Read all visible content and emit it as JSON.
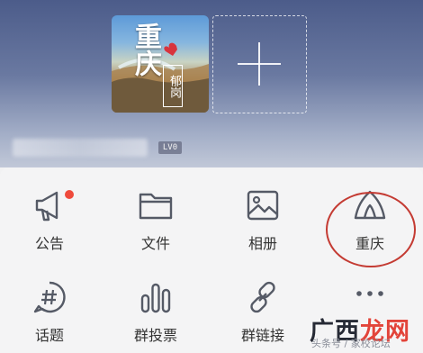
{
  "header": {
    "cover_title": "重庆",
    "cover_subtitle": "郁岗",
    "level_badge": "LV0"
  },
  "menu": [
    {
      "label": "公告",
      "icon": "megaphone-icon",
      "has_dot": true
    },
    {
      "label": "文件",
      "icon": "folder-icon"
    },
    {
      "label": "相册",
      "icon": "photo-album-icon"
    },
    {
      "label": "重庆",
      "icon": "tent-icon",
      "circled": true
    },
    {
      "label": "话题",
      "icon": "hashtag-icon"
    },
    {
      "label": "群投票",
      "icon": "bar-chart-icon"
    },
    {
      "label": "群链接",
      "icon": "link-icon"
    },
    {
      "label": "",
      "icon": "more-icon"
    }
  ],
  "watermark": {
    "logo_prefix": "广西",
    "logo_accent": "龙网",
    "subtitle": "头条号 / 家校论坛"
  },
  "colors": {
    "accent_red": "#ef4a3c",
    "circle_red": "#c43b33",
    "icon_gray": "#555a66"
  }
}
